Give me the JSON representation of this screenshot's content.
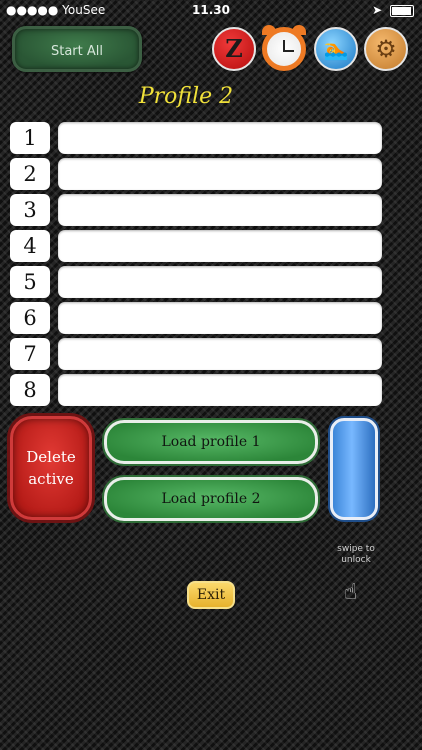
{
  "status_bar": {
    "carrier": "●●●●● YouSee",
    "wifi_icon": "wifi-icon",
    "time": "11.30",
    "location_icon": "location-arrow-icon",
    "battery_percent": "100%"
  },
  "toolbar": {
    "start_all_label": "Start All",
    "icons": [
      "red-z-icon",
      "alarm-clock-icon",
      "swimmer-icon",
      "gear-icon"
    ],
    "z_glyph": "Z",
    "swimmer_glyph": "🏊",
    "gear_glyph": "⚙"
  },
  "profile_title": "Profile 2",
  "rows": [
    {
      "number": "1",
      "value": ""
    },
    {
      "number": "2",
      "value": ""
    },
    {
      "number": "3",
      "value": ""
    },
    {
      "number": "4",
      "value": ""
    },
    {
      "number": "5",
      "value": ""
    },
    {
      "number": "6",
      "value": ""
    },
    {
      "number": "7",
      "value": ""
    },
    {
      "number": "8",
      "value": ""
    }
  ],
  "actions": {
    "delete_line1": "Delete",
    "delete_line2": "active",
    "load_profile_1": "Load profile 1",
    "load_profile_2": "Load profile 2",
    "swipe_hint": "swipe to unlock",
    "exit": "Exit"
  },
  "colors": {
    "accent_yellow": "#f0e13a",
    "start_green": "#2a5735",
    "delete_red": "#c41a16",
    "load_green": "#3a9c49",
    "blue_slider": "#3c86d8",
    "exit_yellow": "#f0c541"
  }
}
